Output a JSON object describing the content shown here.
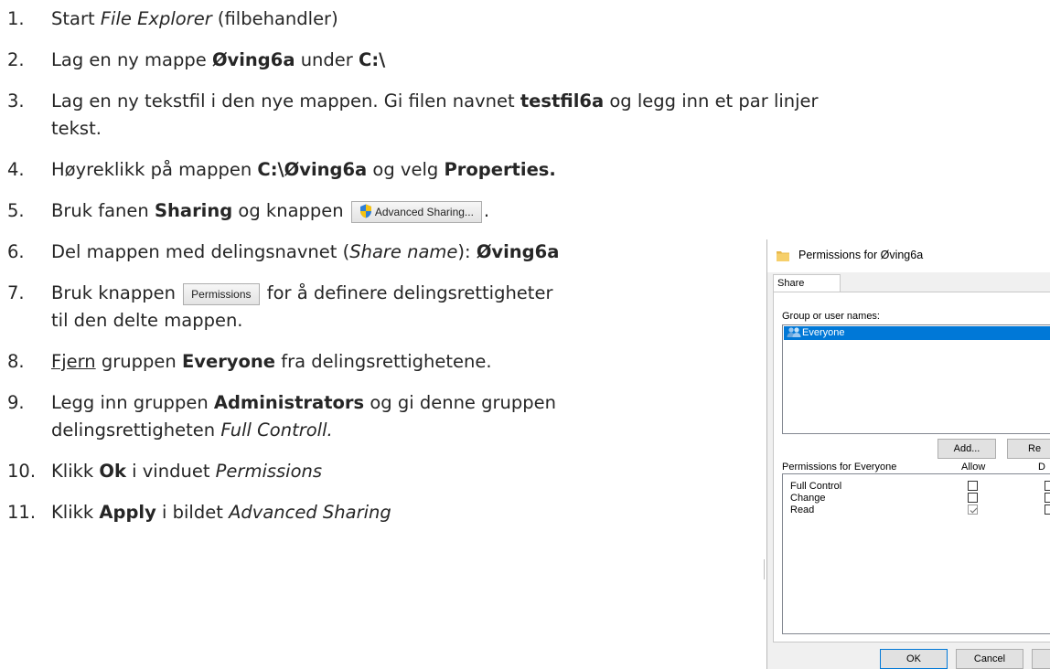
{
  "steps": [
    {
      "num": "1.",
      "parts": [
        {
          "t": "Start "
        },
        {
          "t": "File Explorer",
          "i": true
        },
        {
          "t": " (filbehandler)"
        }
      ]
    },
    {
      "num": "2.",
      "parts": [
        {
          "t": "Lag en ny mappe "
        },
        {
          "t": "Øving6a",
          "b": true
        },
        {
          "t": " under "
        },
        {
          "t": "C:\\",
          "b": true
        }
      ]
    },
    {
      "num": "3.",
      "parts": [
        {
          "t": "Lag en ny tekstfil i den nye mappen. Gi filen navnet "
        },
        {
          "t": "testfil6a",
          "b": true
        },
        {
          "t": " og legg inn et par linjer"
        }
      ]
    },
    {
      "num": "",
      "parts": [
        {
          "t": "tekst."
        }
      ]
    },
    {
      "num": "4.",
      "parts": [
        {
          "t": "Høyreklikk på mappen "
        },
        {
          "t": "C:\\Øving6a",
          "b": true
        },
        {
          "t": " og velg "
        },
        {
          "t": "Properties.",
          "b": true
        }
      ]
    },
    {
      "num": "5.",
      "parts": [
        {
          "t": "Bruk fanen "
        },
        {
          "t": "Sharing",
          "b": true
        },
        {
          "t": " og knappen "
        },
        {
          "btn": "Advanced Sharing...",
          "shield": true
        },
        {
          "t": "."
        }
      ]
    },
    {
      "num": "6.",
      "parts": [
        {
          "t": "Del mappen med delingsnavnet ("
        },
        {
          "t": "Share name",
          "i": true
        },
        {
          "t": "): "
        },
        {
          "t": "Øving6a",
          "b": true
        }
      ]
    },
    {
      "num": "7.",
      "parts": [
        {
          "t": "Bruk knappen "
        },
        {
          "btn": "Permissions"
        },
        {
          "t": " for å definere delingsrettigheter"
        }
      ]
    },
    {
      "num": "",
      "parts": [
        {
          "t": "til den delte mappen."
        }
      ]
    },
    {
      "num": "8.",
      "parts": [
        {
          "t": "Fjern",
          "u": true
        },
        {
          "t": " gruppen "
        },
        {
          "t": "Everyone",
          "b": true
        },
        {
          "t": " fra delingsrettighetene."
        }
      ]
    },
    {
      "num": "9.",
      "parts": [
        {
          "t": "Legg inn gruppen "
        },
        {
          "t": "Administrators",
          "b": true
        },
        {
          "t": " og gi denne gruppen"
        }
      ]
    },
    {
      "num": "",
      "parts": [
        {
          "t": "delingsrettigheten "
        },
        {
          "t": "Full Controll.",
          "i": true
        }
      ]
    },
    {
      "num": "10.",
      "parts": [
        {
          "t": "Klikk "
        },
        {
          "t": "Ok",
          "b": true
        },
        {
          "t": " i vinduet "
        },
        {
          "t": "Permissions",
          "i": true
        }
      ]
    },
    {
      "num": "11.",
      "parts": [
        {
          "t": "Klikk "
        },
        {
          "t": "Apply",
          "b": true
        },
        {
          "t": " i bildet "
        },
        {
          "t": "Advanced Sharing",
          "i": true
        }
      ]
    }
  ],
  "dialog": {
    "title": "Permissions for Øving6a",
    "tab": "Share Permissions",
    "group_label": "Group or user names:",
    "selected_group": "Everyone",
    "add_button": "Add...",
    "remove_button": "Re",
    "perm_for_label": "Permissions for Everyone",
    "col_allow": "Allow",
    "col_deny": "D",
    "permissions": [
      {
        "name": "Full Control",
        "allow": false
      },
      {
        "name": "Change",
        "allow": false
      },
      {
        "name": "Read",
        "allow": true
      }
    ],
    "ok_button": "OK",
    "cancel_button": "Cancel"
  }
}
